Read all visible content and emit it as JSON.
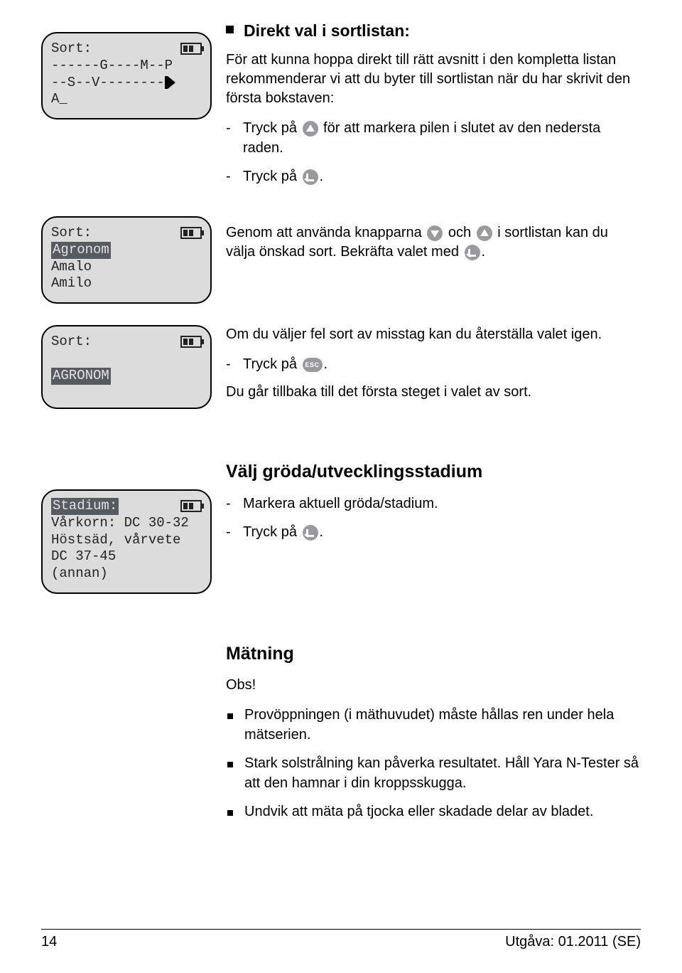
{
  "lcd1": {
    "title": "Sort:",
    "line1": "------G----M--P",
    "line2_prefix": "--S--V--------",
    "cursor_line": "A_"
  },
  "lcd2": {
    "title": "Sort:",
    "sel": "Agronom",
    "l2": "Amalo",
    "l3": "Amilo"
  },
  "lcd3": {
    "title": "Sort:",
    "sel": "AGRONOM"
  },
  "lcd4": {
    "title": "Stadium:",
    "l1": "Vårkorn: DC 30-32",
    "l2": "Höstsäd, vårvete",
    "l3": "DC 37-45",
    "l4": "(annan)"
  },
  "sect1": {
    "heading": "Direkt val i sortlistan:",
    "intro": "För att kunna hoppa direkt till rätt avsnitt i den kompletta listan rekommenderar vi att du byter till sortlistan när du har skrivit den första bokstaven:",
    "step1_a": "Tryck på ",
    "step1_b": " för att markera pilen i slutet av den nedersta raden.",
    "step2_a": "Tryck på ",
    "step2_b": "."
  },
  "sect2": {
    "part1": "Genom att använda knapparna ",
    "part2": " och ",
    "part3": " i sortlistan kan du välja önskad sort. Bekräfta valet med ",
    "part4": "."
  },
  "sect3": {
    "intro": "Om du väljer fel sort av misstag kan du återställa valet igen.",
    "step_a": "Tryck på ",
    "step_b": ".",
    "outro": "Du går tillbaka till det första steget i valet av sort."
  },
  "sect4": {
    "heading": "Välj gröda/utvecklingsstadium",
    "step1": "Markera aktuell gröda/stadium.",
    "step2_a": "Tryck på ",
    "step2_b": "."
  },
  "sect5": {
    "heading": "Mätning",
    "obs": "Obs!",
    "b1": "Provöppningen (i mäthuvudet) måste hållas ren under hela mätserien.",
    "b2": "Stark solstrålning kan påverka resultatet. Håll Yara N-Tester så att den hamnar i din kroppsskugga.",
    "b3": "Undvik att mäta på tjocka eller skadade delar av bladet."
  },
  "footer": {
    "left": "14",
    "right": "Utgåva: 01.2011 (SE)"
  }
}
